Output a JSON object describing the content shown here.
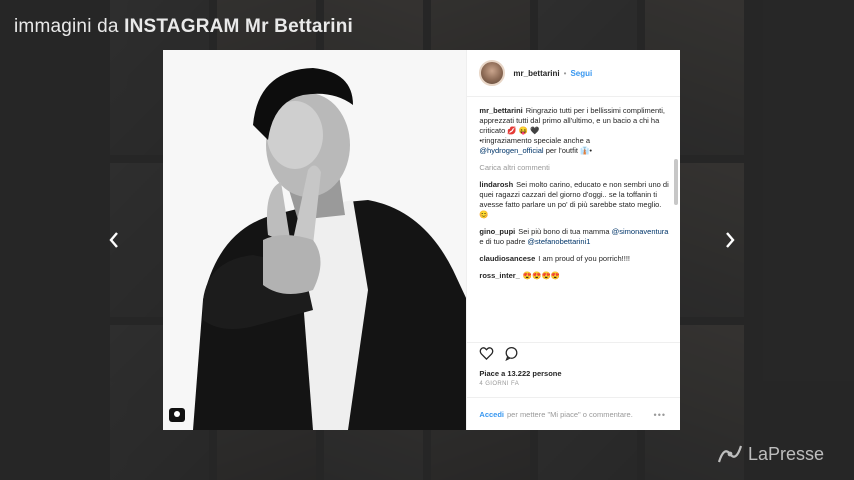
{
  "caption": {
    "prefix": "immagini da ",
    "bold": "INSTAGRAM Mr Bettarini"
  },
  "nav": {
    "prev_icon": "chevron-left-icon",
    "next_icon": "chevron-right-icon"
  },
  "post": {
    "username": "mr_bettarini",
    "separator": "•",
    "follow_label": "Segui",
    "caption_user": "mr_bettarini",
    "caption_text": "Ringrazio tutti per i bellissimi complimenti, apprezzati tutti dal primo all'ultimo, e un bacio a chi ha criticato 💋 😝 🖤",
    "caption_thanks": "•ringraziamento speciale anche a",
    "caption_mention": "@hydrogen_official",
    "caption_outfit": "per l'outfit 👔•",
    "load_more": "Carica altri commenti",
    "comments": [
      {
        "user": "lindarosh",
        "text": "Sei molto carino, educato e non sembri uno di quei ragazzi cazzari del giorno d'oggi.. se la toffanin ti avesse fatto parlare un po' di più sarebbe stato meglio. 😊"
      },
      {
        "user": "gino_pupi",
        "text": "Sei più bono di tua mamma",
        "mention1": "@simonaventura",
        "mid": "e di tuo padre",
        "mention2": "@stefanobettarini1"
      },
      {
        "user": "claudiosancese",
        "text": "I am proud of you porrich!!!!"
      },
      {
        "user": "ross_inter_",
        "text": "😍😍😍😍"
      }
    ],
    "likes": "Piace a 13.222 persone",
    "date": "4 GIORNI FA",
    "login_link": "Accedi",
    "login_text": "per mettere \"Mi piace\" o commentare.",
    "more_icon": "ellipsis-icon"
  },
  "watermark": {
    "text": "LaPresse"
  }
}
